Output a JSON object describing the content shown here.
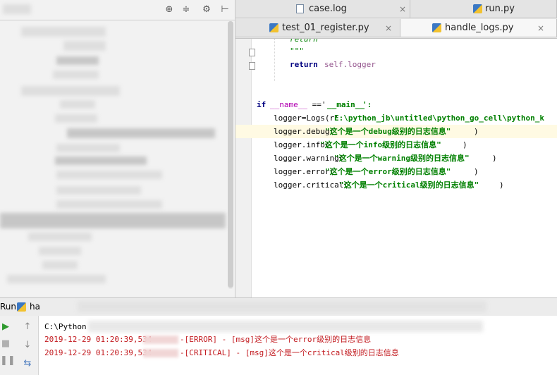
{
  "editor_tabs": {
    "row1": [
      {
        "label": "case.log",
        "icon": "log-file-icon"
      },
      {
        "label": "run.py",
        "icon": "python-file-icon"
      }
    ],
    "row2": [
      {
        "label": "test_01_register.py",
        "icon": "python-file-icon"
      },
      {
        "label": "handle_logs.py",
        "icon": "python-file-icon",
        "active": true
      }
    ],
    "close_glyph": "×"
  },
  "code": {
    "docstring_top": "return",
    "docstring_end": "\"\"\"",
    "return_kw": "return",
    "return_expr": "self.logger",
    "if_line": {
      "kw": "if",
      "name": "__name__",
      "op": " =='",
      "main": "__main__",
      "tail": "':"
    },
    "logger_init": {
      "prefix": "logger=Logs(r'",
      "path": "E:\\python_jb\\untitled\\python_go_cell\\python_k"
    },
    "log_calls": [
      {
        "method": "logger.debug(",
        "msg": "\"这个是一个debug级别的日志信息\"",
        "close": ")"
      },
      {
        "method": "logger.info(",
        "msg": "\"这个是一个info级别的日志信息\"",
        "close": ")"
      },
      {
        "method": "logger.warning(",
        "msg": "\"这个是一个warning级别的日志信息\"",
        "close": ")"
      },
      {
        "method": "logger.error(",
        "msg": "\"这个是一个error级别的日志信息\"",
        "close": ")"
      },
      {
        "method": "logger.critical(",
        "msg": "\"这个是一个critical级别的日志信息\"",
        "close": ")"
      }
    ]
  },
  "run_panel": {
    "label": "Run",
    "config_name": "ha",
    "console_lines": [
      {
        "text": "C:\\Python"
      },
      {
        "timestamp": "2019-12-29 01:20:39,534",
        "rest": "-[ERROR] - [msg]这个是一个error级别的日志信息"
      },
      {
        "timestamp": "2019-12-29 01:20:39,534",
        "rest": "-[CRITICAL] - [msg]这个是一个critical级别的日志信息"
      }
    ]
  },
  "colors": {
    "error_text": "#c2191e",
    "keyword": "#000080",
    "string": "#008000",
    "highlight_line": "#fffae3"
  }
}
